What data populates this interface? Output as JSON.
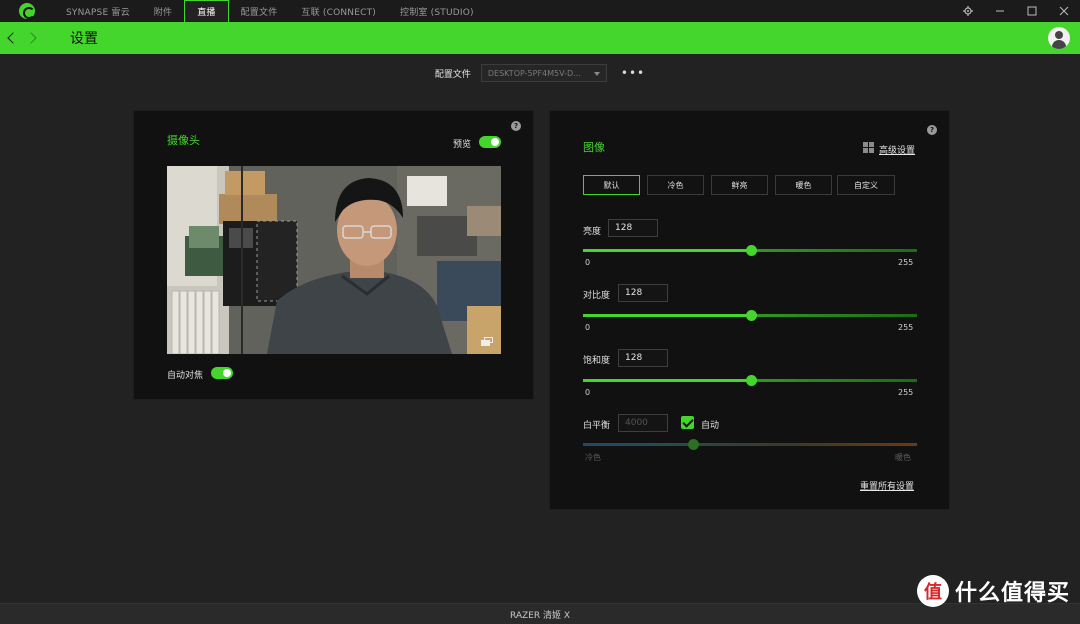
{
  "nav": {
    "tabs": [
      {
        "label": "SYNAPSE 雷云"
      },
      {
        "label": "附件"
      },
      {
        "label": "直播"
      },
      {
        "label": "配置文件"
      },
      {
        "label": "互联 (CONNECT)"
      },
      {
        "label": "控制室 (STUDIO)"
      }
    ],
    "active_tab": "直播",
    "window_controls": {
      "settings_icon": "gear-icon",
      "minimize_icon": "minimize-icon",
      "maximize_icon": "maximize-icon",
      "close_icon": "close-icon"
    }
  },
  "header": {
    "title": "设置",
    "back_icon": "chevron-left-icon",
    "forward_icon": "chevron-right-icon",
    "avatar_icon": "user-avatar-icon",
    "accent_color": "#44d62c"
  },
  "profile": {
    "label": "配置文件",
    "selected": "DESKTOP-5PF4M5V-D...",
    "more_label": "•••"
  },
  "camera_panel": {
    "title": "摄像头",
    "help": "?",
    "preview_label": "预览",
    "preview_enabled": true,
    "autofocus_label": "自动对焦",
    "autofocus_enabled": true,
    "expand_icon": "fullscreen-icon"
  },
  "image_panel": {
    "title": "图像",
    "help": "?",
    "advanced_label": "高级设置",
    "advanced_icon": "windows-icon",
    "presets": [
      "默认",
      "冷色",
      "鲜亮",
      "暖色",
      "自定义"
    ],
    "active_preset": "默认",
    "brightness": {
      "label": "亮度",
      "value": "128",
      "min": "0",
      "max": "255",
      "level": 128
    },
    "contrast": {
      "label": "对比度",
      "value": "128",
      "min": "0",
      "max": "255",
      "level": 128
    },
    "saturation": {
      "label": "饱和度",
      "value": "128",
      "min": "0",
      "max": "255",
      "level": 128
    },
    "white_balance": {
      "label": "白平衡",
      "value": "4000",
      "auto_label": "自动",
      "auto_checked": true,
      "min_label": "冷色",
      "max_label": "暖色",
      "level_fraction": 0.33
    },
    "reset_label": "重置所有设置"
  },
  "footer": {
    "device": "RAZER 清姬 X"
  },
  "watermark": {
    "badge": "值",
    "text": "什么值得买"
  }
}
